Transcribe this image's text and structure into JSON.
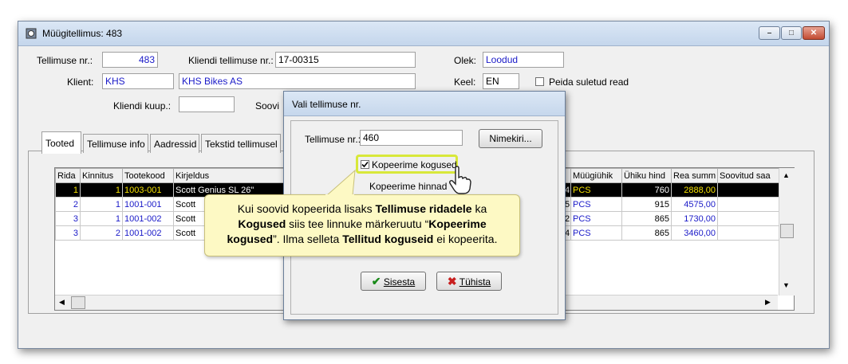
{
  "window": {
    "title": "Müügitellimus: 483"
  },
  "header": {
    "order_no_label": "Tellimuse nr.:",
    "order_no_value": "483",
    "client_order_label": "Kliendi tellimuse nr.:",
    "client_order_value": "17-00315",
    "status_label": "Olek:",
    "status_value": "Loodud",
    "client_label": "Klient:",
    "client_code": "KHS",
    "client_name": "KHS Bikes AS",
    "lang_label": "Keel:",
    "lang_value": "EN",
    "hide_closed_label": "Peida suletud read",
    "client_date_label": "Kliendi kuup.:",
    "client_date_value": "",
    "wish_label": "Soovi"
  },
  "tabs": [
    "Tooted",
    "Tellimuse info",
    "Aadressid",
    "Tekstid tellimusel"
  ],
  "grid": {
    "columns_left": [
      "Rida",
      "Kinnitus",
      "Tootekood",
      "Kirjeldus"
    ],
    "columns_right": [
      "Müügiühik",
      "Ühiku hind",
      "Rea summ",
      "Soovitud saa"
    ],
    "rows": [
      {
        "rida": "1",
        "kinnitus": "1",
        "kood": "1003-001",
        "kirjeldus": "Scott Genius SL 26\"",
        "qty": "4",
        "yhik": "PCS",
        "hind": "760",
        "summa": "2888,00"
      },
      {
        "rida": "2",
        "kinnitus": "1",
        "kood": "1001-001",
        "kirjeldus": "Scott",
        "qty": "5",
        "yhik": "PCS",
        "hind": "915",
        "summa": "4575,00"
      },
      {
        "rida": "3",
        "kinnitus": "1",
        "kood": "1001-002",
        "kirjeldus": "Scott",
        "qty": "2",
        "yhik": "PCS",
        "hind": "865",
        "summa": "1730,00"
      },
      {
        "rida": "3",
        "kinnitus": "2",
        "kood": "1001-002",
        "kirjeldus": "Scott",
        "qty": "4",
        "yhik": "PCS",
        "hind": "865",
        "summa": "3460,00"
      }
    ]
  },
  "dialog": {
    "title": "Vali tellimuse nr.",
    "order_label": "Tellimuse nr.:",
    "order_value": "460",
    "list_button": "Nimekiri...",
    "copy_qty_label": "Kopeerime kogused",
    "copy_price_label": "Kopeerime hinnad",
    "ok_button": "Sisesta",
    "cancel_button": "Tühista"
  },
  "callout": {
    "p1": "Kui soovid kopeerida lisaks ",
    "b1": "Tellimuse ridadele",
    "p2": " ka ",
    "b2": "Kogused",
    "p3": " siis tee linnuke märkeruutu “",
    "b3": "Kopeerime kogused",
    "p4": "”. Ilma selleta ",
    "b4": "Tellitud koguseid",
    "p5": " ei kopeerita."
  },
  "colors": {
    "accent_text": "#1a1ac8",
    "highlight": "#d8e83a",
    "callout_bg": "#fdf9c4"
  }
}
